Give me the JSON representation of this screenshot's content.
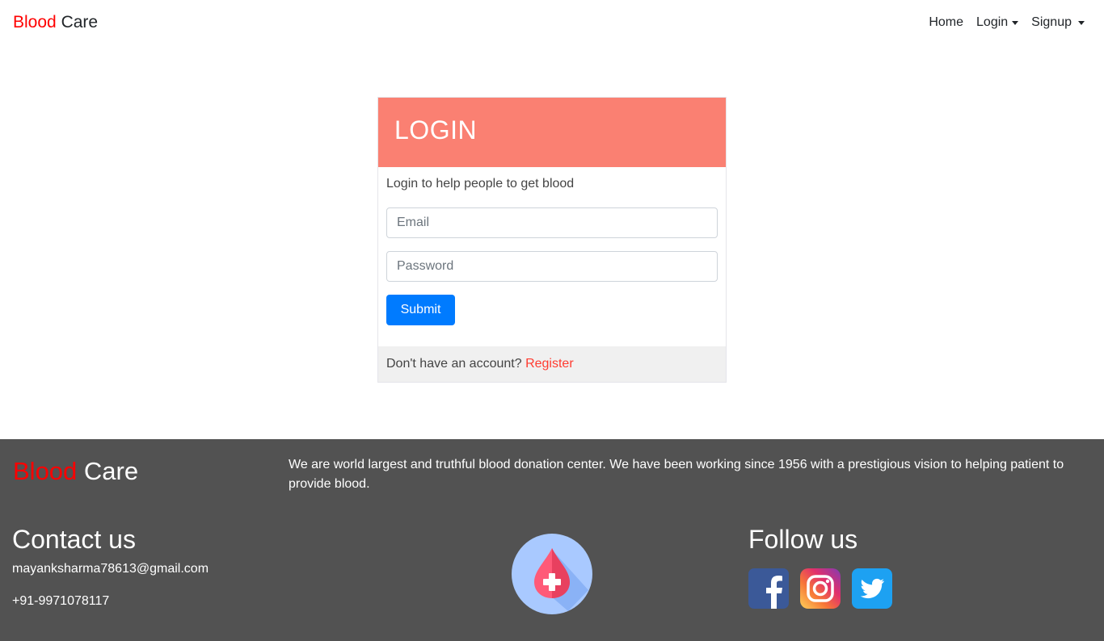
{
  "navbar": {
    "brand_part1": "Blood",
    "brand_part2": "Care",
    "links": [
      {
        "label": "Home"
      },
      {
        "label": "Login"
      },
      {
        "label": "Signup"
      }
    ]
  },
  "login_card": {
    "title": "LOGIN",
    "subtitle": "Login to help people to get blood",
    "email_placeholder": "Email",
    "password_placeholder": "Password",
    "submit_label": "Submit",
    "footer_text": "Don't have an account?",
    "register_label": "Register"
  },
  "footer": {
    "brand_part1": "Blood",
    "brand_part2": "Care",
    "description": "We are world largest and truthful blood donation center. We have been working since 1956 with a prestigious vision to helping patient to provide blood.",
    "contact_title": "Contact us",
    "email": "mayanksharma78613@gmail.com",
    "phone": "+91-9971078117",
    "follow_title": "Follow us",
    "social_icons": [
      "facebook-icon",
      "instagram-icon",
      "twitter-icon"
    ]
  },
  "colors": {
    "brand_red": "#ff0000",
    "card_header": "#fa8072",
    "submit_blue": "#007bff",
    "footer_bg": "#525252",
    "register_link": "#ff3b30"
  }
}
